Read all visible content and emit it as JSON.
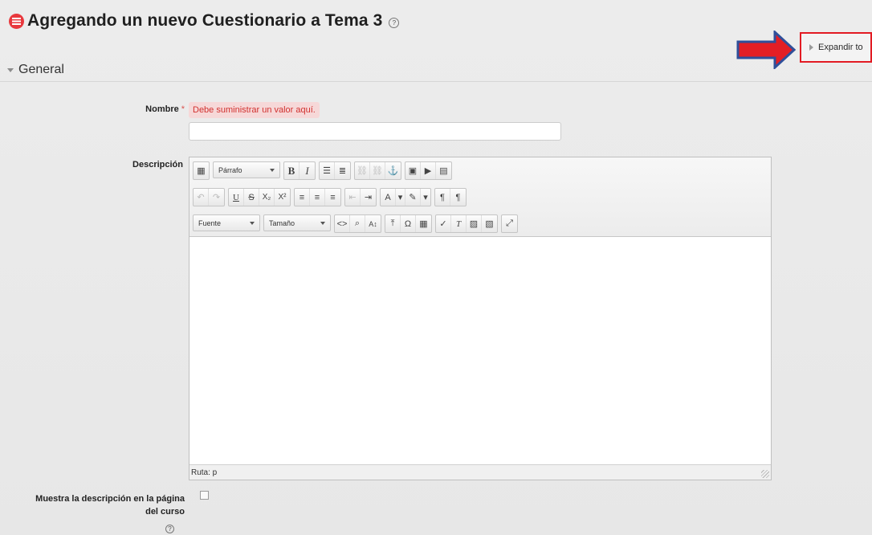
{
  "page": {
    "title": "Agregando un nuevo Cuestionario a Tema 3"
  },
  "header": {
    "expand_all_label": "Expandir to"
  },
  "section": {
    "title": "General"
  },
  "fields": {
    "name": {
      "label": "Nombre",
      "required_mark": "*",
      "error": "Debe suministrar un valor aquí.",
      "value": ""
    },
    "description": {
      "label": "Descripción"
    },
    "show_description": {
      "label_line1": "Muestra la descripción en la página",
      "label_line2": "del curso",
      "checked": false
    }
  },
  "editor": {
    "format_select": "Párrafo",
    "font_select": "Fuente",
    "size_select": "Tamaño",
    "path_label": "Ruta: p",
    "content": ""
  },
  "colors": {
    "accent_red": "#e21b23",
    "error_bg": "#f6d8d8",
    "arrow_blue": "#2f4f9a"
  }
}
